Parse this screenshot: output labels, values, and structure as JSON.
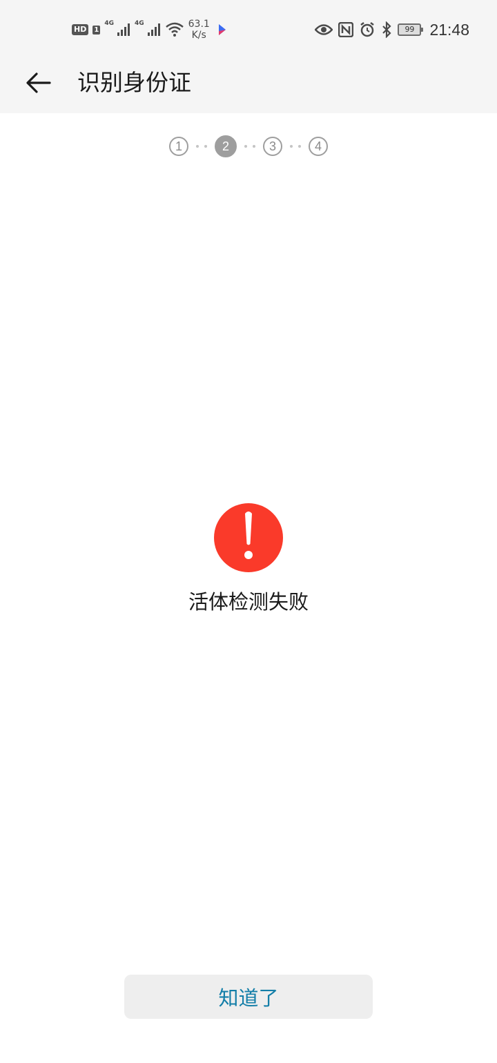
{
  "status_bar": {
    "hd_label": "HD",
    "sim_number": "1",
    "network_1": "4G",
    "network_2": "4G",
    "speed_value": "63.1",
    "speed_unit": "K/s",
    "battery_level": "99",
    "time": "21:48",
    "icons": [
      "hd-icon",
      "signal-icon",
      "signal-icon",
      "wifi-icon",
      "app-icon",
      "eye-icon",
      "nfc-icon",
      "alarm-icon",
      "bluetooth-icon",
      "battery-icon"
    ]
  },
  "app_bar": {
    "back_icon": "arrow-left-icon",
    "title": "识别身份证"
  },
  "steps": {
    "items": [
      "1",
      "2",
      "3",
      "4"
    ],
    "active_index": 1
  },
  "result": {
    "icon": "exclamation-icon",
    "icon_color": "#fa3a2a",
    "message": "活体检测失败"
  },
  "actions": {
    "confirm_label": "知道了",
    "confirm_color": "#137ea8"
  }
}
